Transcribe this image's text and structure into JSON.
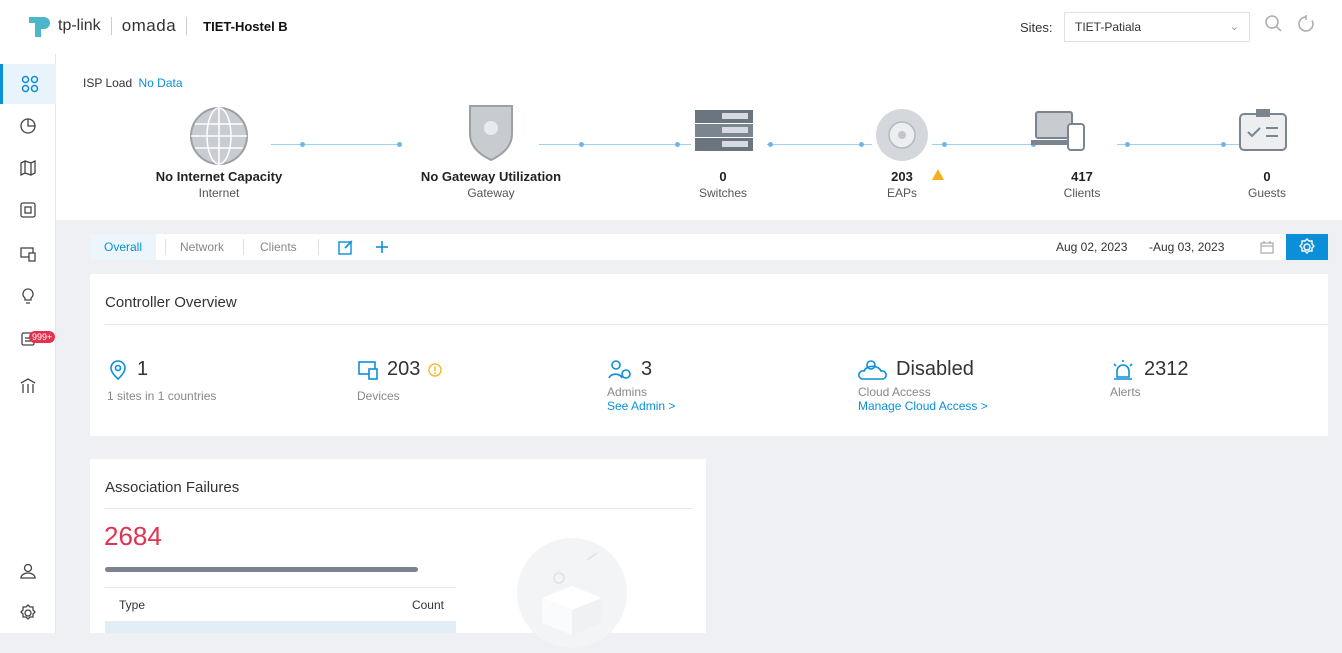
{
  "header": {
    "brand": "tp-link",
    "product": "omada",
    "site_title": "TIET-Hostel B",
    "sites_label": "Sites:",
    "sites_value": "TIET-Patiala"
  },
  "topology": {
    "isp_label": "ISP Load",
    "isp_value": "No Data",
    "nodes": [
      {
        "value": "No Internet Capacity",
        "label": "Internet"
      },
      {
        "value": "No Gateway Utilization",
        "label": "Gateway"
      },
      {
        "value": "0",
        "label": "Switches"
      },
      {
        "value": "203",
        "label": "EAPs"
      },
      {
        "value": "417",
        "label": "Clients"
      },
      {
        "value": "0",
        "label": "Guests"
      }
    ]
  },
  "tabs": [
    "Overall",
    "Network",
    "Clients"
  ],
  "date_from": "Aug 02, 2023",
  "date_to": "-Aug 03, 2023",
  "overview": {
    "title": "Controller Overview",
    "sites": {
      "value": "1",
      "label": "1 sites in 1 countries"
    },
    "devices": {
      "value": "203",
      "label": "Devices"
    },
    "admins": {
      "value": "3",
      "label": "Admins",
      "link": "See Admin >"
    },
    "cloud": {
      "value": "Disabled",
      "label": "Cloud Access",
      "link": "Manage Cloud Access >"
    },
    "alerts": {
      "value": "2312",
      "label": "Alerts"
    }
  },
  "assoc": {
    "title": "Association Failures",
    "total": "2684",
    "col_type": "Type",
    "col_count": "Count"
  },
  "nav_badge": "999+",
  "colors": {
    "accent": "#0a8fd8",
    "danger": "#e2324f",
    "warning": "#f3b21b"
  }
}
